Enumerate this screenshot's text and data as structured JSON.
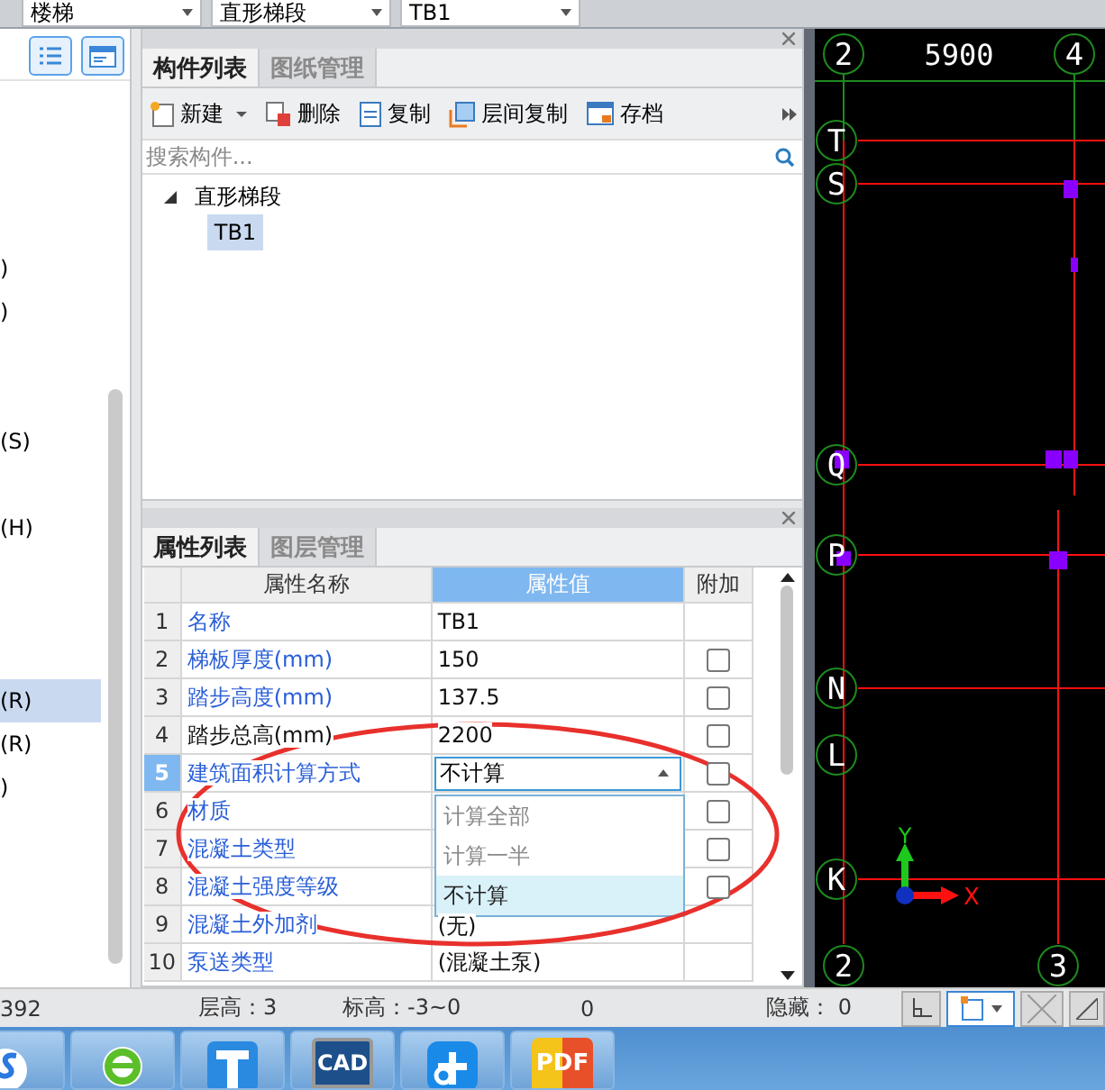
{
  "top_selects": [
    {
      "value": "楼梯"
    },
    {
      "value": "直形梯段"
    },
    {
      "value": "TB1"
    }
  ],
  "left_panel": {
    "items": [
      {
        "label": ")",
        "selected": false
      },
      {
        "label": ")",
        "selected": false
      },
      {
        "label": "(S)",
        "selected": false
      },
      {
        "label": "(H)",
        "selected": false
      },
      {
        "label": "(R)",
        "selected": true
      },
      {
        "label": "(R)",
        "selected": false
      },
      {
        "label": ")",
        "selected": false
      }
    ]
  },
  "component_panel": {
    "tabs": [
      {
        "label": "构件列表",
        "selected": true
      },
      {
        "label": "图纸管理",
        "selected": false
      }
    ],
    "actions": [
      {
        "label": "新建",
        "kind": "new",
        "has_menu": true
      },
      {
        "label": "删除",
        "kind": "delete",
        "has_menu": false
      },
      {
        "label": "复制",
        "kind": "copy",
        "has_menu": false
      },
      {
        "label": "层间复制",
        "kind": "floorcopy",
        "has_menu": false
      },
      {
        "label": "存档",
        "kind": "save",
        "has_menu": false
      }
    ],
    "search": {
      "placeholder": "搜索构件..."
    },
    "tree": [
      {
        "label": "直形梯段",
        "expanded": true,
        "selected": false,
        "children": [
          {
            "label": "TB1",
            "selected": true
          }
        ]
      }
    ]
  },
  "property_panel": {
    "tabs": [
      {
        "label": "属性列表",
        "selected": true
      },
      {
        "label": "图层管理",
        "selected": false
      }
    ],
    "columns": [
      "属性名称",
      "属性值",
      "附加"
    ],
    "rows": [
      {
        "index": "1",
        "name": "名称",
        "public": true,
        "value": "TB1",
        "selected": false
      },
      {
        "index": "2",
        "name": "梯板厚度(mm)",
        "public": true,
        "value": "150",
        "checked": false,
        "selected": false
      },
      {
        "index": "3",
        "name": "踏步高度(mm)",
        "public": true,
        "value": "137.5",
        "checked": false,
        "selected": false
      },
      {
        "index": "4",
        "name": "踏步总高(mm)",
        "public": false,
        "value": "2200",
        "checked": false,
        "selected": false
      },
      {
        "index": "5",
        "name": "建筑面积计算方式",
        "public": true,
        "value": "不计算",
        "checked": false,
        "selected": true,
        "dropdown": {
          "open": true,
          "options": [
            {
              "label": "计算全部",
              "selected": false
            },
            {
              "label": "计算一半",
              "selected": false
            },
            {
              "label": "不计算",
              "selected": true
            }
          ]
        }
      },
      {
        "index": "6",
        "name": "材质",
        "public": true,
        "checked": false,
        "selected": false
      },
      {
        "index": "7",
        "name": "混凝土类型",
        "public": true,
        "checked": false,
        "selected": false
      },
      {
        "index": "8",
        "name": "混凝土强度等级",
        "public": true,
        "checked": false,
        "selected": false
      },
      {
        "index": "9",
        "name": "混凝土外加剂",
        "public": true,
        "value": "(无)",
        "selected": false
      },
      {
        "index": "10",
        "name": "泵送类型",
        "public": true,
        "value": "(混凝土泵)",
        "selected": false
      }
    ]
  },
  "canvas": {
    "dimension": "5900",
    "top_axes": [
      "2",
      "4"
    ],
    "row_axes": [
      "T",
      "S",
      "Q",
      "P",
      "N",
      "L",
      "K"
    ],
    "bottom_axes": [
      "2",
      "3"
    ],
    "ucs": {
      "y_label": "Y",
      "x_label": "X"
    }
  },
  "status_bar": [
    "392",
    "层高：3",
    "标高：-3~0",
    "0",
    "隐藏： 0"
  ],
  "taskbar": [
    {
      "kind": "sogou"
    },
    {
      "kind": "ie"
    },
    {
      "kind": "hammer"
    },
    {
      "kind": "cad",
      "label": "CAD"
    },
    {
      "kind": "fan"
    },
    {
      "kind": "pdf",
      "label": "PDF"
    }
  ]
}
